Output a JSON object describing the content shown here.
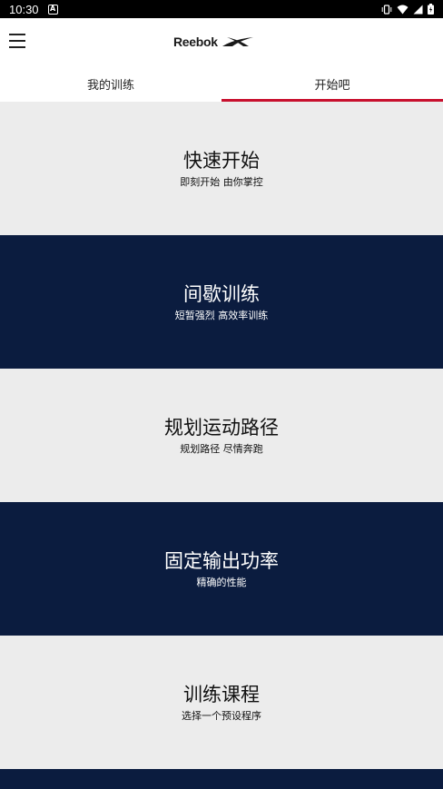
{
  "status_bar": {
    "time": "10:30",
    "badge": "A"
  },
  "app_bar": {
    "logo_text": "Reebok"
  },
  "tabs": [
    {
      "label": "我的训练",
      "active": false
    },
    {
      "label": "开始吧",
      "active": true
    }
  ],
  "cards": [
    {
      "title": "快速开始",
      "subtitle": "即刻开始 由你掌控",
      "theme": "light"
    },
    {
      "title": "间歇训练",
      "subtitle": "短暂强烈 高效率训练",
      "theme": "dark"
    },
    {
      "title": "规划运动路径",
      "subtitle": "规划路径 尽情奔跑",
      "theme": "light"
    },
    {
      "title": "固定输出功率",
      "subtitle": "精确的性能",
      "theme": "dark"
    },
    {
      "title": "训练课程",
      "subtitle": "选择一个预设程序",
      "theme": "light"
    }
  ],
  "colors": {
    "accent": "#c8102e",
    "dark_card": "#0b1c3f",
    "light_card": "#ececec"
  }
}
